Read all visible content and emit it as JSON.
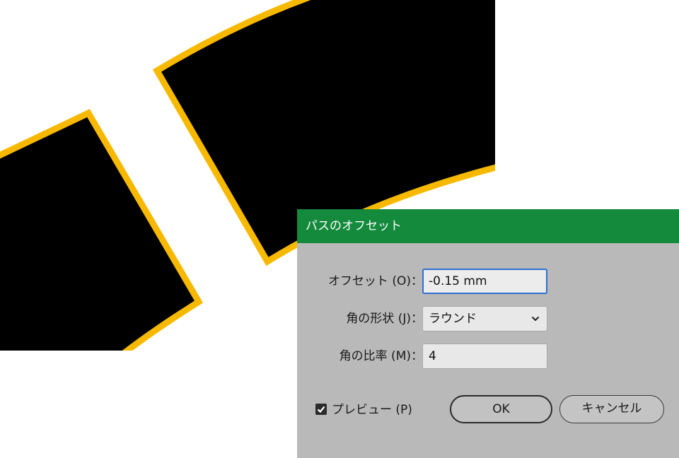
{
  "dialog": {
    "title": "パスのオフセット",
    "offset": {
      "label": "オフセット (O)：",
      "value": "-0.15 mm"
    },
    "joins": {
      "label": "角の形状 (J)：",
      "selected": "ラウンド"
    },
    "miter_limit": {
      "label": "角の比率 (M)：",
      "value": "4"
    },
    "preview": {
      "label": "プレビュー (P)",
      "checked": true
    },
    "ok_label": "OK",
    "cancel_label": "キャンセル"
  },
  "colors": {
    "title_bar": "#148a3c",
    "dialog_bg": "#b9b9b9",
    "shape_fill": "#000000",
    "shape_stroke": "#f7b900",
    "focus_ring": "#2e6fd2"
  },
  "icons": [
    "chevron-down-icon",
    "checkmark-icon"
  ]
}
